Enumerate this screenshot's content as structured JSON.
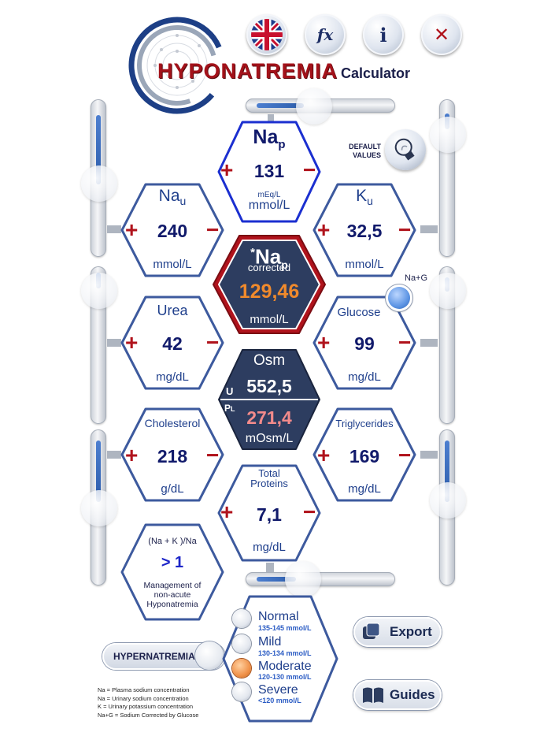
{
  "header": {
    "title_big": "HYPONATREMIA",
    "title_small": "Calculator",
    "buttons": [
      {
        "name": "language-button",
        "icon": "uk-flag-icon",
        "label": ""
      },
      {
        "name": "formula-button",
        "icon": "fx-icon",
        "label": "fx"
      },
      {
        "name": "info-button",
        "icon": "info-icon",
        "label": "i"
      },
      {
        "name": "close-button",
        "icon": "close-icon",
        "label": "✕"
      }
    ]
  },
  "default_values": {
    "label_line1": "DEFAULT",
    "label_line2": "VALUES",
    "icon": "lightbulb-icon"
  },
  "cells": {
    "nap": {
      "label": "Na",
      "sub": "p",
      "value": "131",
      "unit_small": "mEq/L",
      "unit": "mmol/L"
    },
    "nau": {
      "label": "Na",
      "sub": "u",
      "value": "240",
      "unit": "mmol/L"
    },
    "ku": {
      "label": "K",
      "sub": "u",
      "value": "32,5",
      "unit": "mmol/L"
    },
    "urea": {
      "label": "Urea",
      "value": "42",
      "unit": "mg/dL"
    },
    "glucose": {
      "label": "Glucose",
      "value": "99",
      "unit": "mg/dL",
      "toggle_label": "Na+G"
    },
    "cholesterol": {
      "label": "Cholesterol",
      "value": "218",
      "unit": "g/dL"
    },
    "triglycerides": {
      "label": "Triglycerides",
      "value": "169",
      "unit": "mg/dL"
    },
    "proteins": {
      "label_line1": "Total",
      "label_line2": "Proteins",
      "value": "7,1",
      "unit": "mg/dL"
    },
    "ratio": {
      "formula": "(Na  + K )/Na",
      "value": "> 1",
      "note_line1": "Management of",
      "note_line2": "non-acute",
      "note_line3": "Hyponatremia"
    }
  },
  "corrected": {
    "star": "*",
    "label": "Na",
    "sub": "p",
    "sublabel": "corrected",
    "value": "129,46",
    "unit": "mmol/L"
  },
  "osm": {
    "label": "Osm",
    "u_label": "U",
    "u_value": "552,5",
    "pl_label": "P",
    "pl_sub": "L",
    "pl_value": "271,4",
    "unit": "mOsm/L"
  },
  "plus": "+",
  "minus": "−",
  "severity": [
    {
      "name": "Normal",
      "range": "135-145  mmol/L",
      "active": false
    },
    {
      "name": "Mild",
      "range": "130-134  mmol/L",
      "active": false
    },
    {
      "name": "Moderate",
      "range": "120-130  mmol/L",
      "active": true
    },
    {
      "name": "Severe",
      "range": "<120  mmol/L",
      "active": false
    }
  ],
  "hypernatremia_label": "HYPERNATREMIA",
  "export_label": "Export",
  "guides_label": "Guides",
  "legend": [
    "Na = Plasma sodium concentration",
    "Na = Urinary sodium concentration",
    "K = Urinary potassium concentration",
    "Na+G = Sodium Corrected by Glucose"
  ],
  "colors": {
    "accent_red": "#b0131c",
    "navy": "#111a6b",
    "blue": "#1f3f8c",
    "orange": "#f08a2c",
    "pink": "#f38b8b",
    "dark_panel": "#2b3a5c"
  }
}
